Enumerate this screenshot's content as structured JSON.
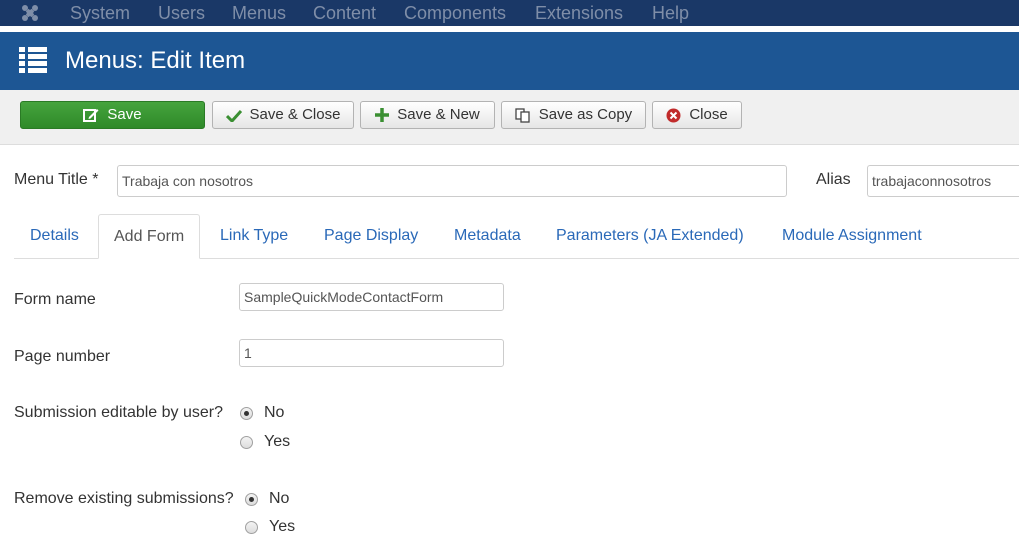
{
  "navbar": {
    "logo_icon": "joomla-logo-icon",
    "items": [
      "System",
      "Users",
      "Menus",
      "Content",
      "Components",
      "Extensions",
      "Help"
    ]
  },
  "header": {
    "icon": "list-icon",
    "title": "Menus: Edit Item"
  },
  "toolbar": {
    "save": "Save",
    "save_close": "Save & Close",
    "save_new": "Save & New",
    "save_copy": "Save as Copy",
    "close": "Close"
  },
  "title_row": {
    "menu_title_label": "Menu Title *",
    "menu_title_value": "Trabaja con nosotros",
    "alias_label": "Alias",
    "alias_value": "trabajaconnosotros"
  },
  "tabs": [
    "Details",
    "Add Form",
    "Link Type",
    "Page Display",
    "Metadata",
    "Parameters (JA Extended)",
    "Module Assignment"
  ],
  "active_tab": "Add Form",
  "form": {
    "form_name_label": "Form name",
    "form_name_value": "SampleQuickModeContactForm",
    "page_number_label": "Page number",
    "page_number_value": "1",
    "editable_label": "Submission editable by user?",
    "editable_options": [
      "No",
      "Yes"
    ],
    "editable_selected": "No",
    "remove_label": "Remove existing submissions?",
    "remove_options": [
      "No",
      "Yes"
    ],
    "remove_selected": "No"
  },
  "colors": {
    "navbar_bg": "#1a3867",
    "header_bg": "#1d5694",
    "save_green": "#3a9a33",
    "link_blue": "#2a69b8"
  }
}
